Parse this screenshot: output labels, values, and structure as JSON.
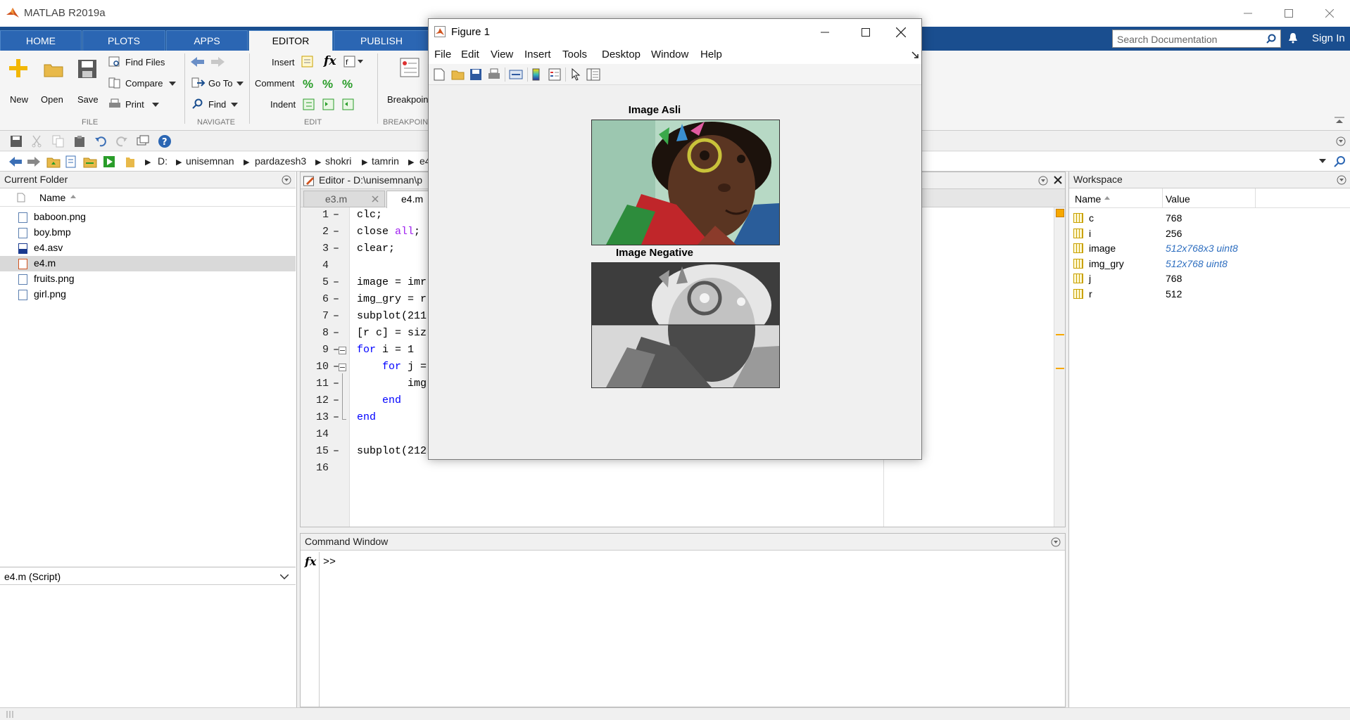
{
  "app": {
    "title": "MATLAB R2019a"
  },
  "tabs": [
    "HOME",
    "PLOTS",
    "APPS",
    "EDITOR",
    "PUBLISH"
  ],
  "search": {
    "placeholder": "Search Documentation"
  },
  "sign_in": "Sign In",
  "ribbon": {
    "new": "New",
    "open": "Open",
    "save": "Save",
    "find_files": "Find Files",
    "compare": "Compare",
    "print": "Print",
    "go_to": "Go To",
    "find": "Find",
    "insert": "Insert",
    "comment": "Comment",
    "indent": "Indent",
    "breakpoints": "Breakpoints",
    "groups": {
      "file": "FILE",
      "navigate": "NAVIGATE",
      "edit": "EDIT",
      "breakpoints": "BREAKPOINTS"
    }
  },
  "address": {
    "crumbs": [
      "D:",
      "unisemnan",
      "pardazesh3",
      "shokri",
      "tamrin",
      "e4"
    ]
  },
  "current_folder": {
    "title": "Current Folder",
    "column": "Name",
    "files": [
      "baboon.png",
      "boy.bmp",
      "e4.asv",
      "e4.m",
      "fruits.png",
      "girl.png"
    ],
    "selected": "e4.m",
    "details": "e4.m  (Script)"
  },
  "editor": {
    "title": "Editor - D:\\unisemnan\\p",
    "tabs": [
      "e3.m",
      "e4.m"
    ],
    "active_tab": "e4.m",
    "lines": [
      {
        "n": "1",
        "code": "clc;"
      },
      {
        "n": "2",
        "code": "close all;"
      },
      {
        "n": "3",
        "code": "clear;"
      },
      {
        "n": "4",
        "code": ""
      },
      {
        "n": "5",
        "code": "image = imr"
      },
      {
        "n": "6",
        "code": "img_gry = r"
      },
      {
        "n": "7",
        "code": "subplot(211"
      },
      {
        "n": "8",
        "code": "[r c] = siz"
      },
      {
        "n": "9",
        "code": "for i = 1"
      },
      {
        "n": "10",
        "code": "    for j ="
      },
      {
        "n": "11",
        "code": "        img"
      },
      {
        "n": "12",
        "code": "    end"
      },
      {
        "n": "13",
        "code": "end"
      },
      {
        "n": "14",
        "code": ""
      },
      {
        "n": "15",
        "code": "subplot(212"
      },
      {
        "n": "16",
        "code": ""
      }
    ]
  },
  "command": {
    "title": "Command Window",
    "prompt": ">>",
    "fx": "fx"
  },
  "workspace": {
    "title": "Workspace",
    "columns": [
      "Name",
      "Value"
    ],
    "vars": [
      {
        "name": "c",
        "value": "768",
        "italic": false
      },
      {
        "name": "i",
        "value": "256",
        "italic": false
      },
      {
        "name": "image",
        "value": "512x768x3 uint8",
        "italic": true
      },
      {
        "name": "img_gry",
        "value": "512x768 uint8",
        "italic": true
      },
      {
        "name": "j",
        "value": "768",
        "italic": false
      },
      {
        "name": "r",
        "value": "512",
        "italic": false
      }
    ]
  },
  "figure": {
    "title": "Figure 1",
    "menu": [
      "File",
      "Edit",
      "View",
      "Insert",
      "Tools",
      "Desktop",
      "Window",
      "Help"
    ],
    "axes": [
      {
        "title": "Image Asli"
      },
      {
        "title": "Image Negative"
      }
    ]
  },
  "colors": {
    "tabbar": "#1a4e8f",
    "accent": "#2b66b3",
    "keyword": "#0000ff",
    "string": "#a020f0"
  }
}
